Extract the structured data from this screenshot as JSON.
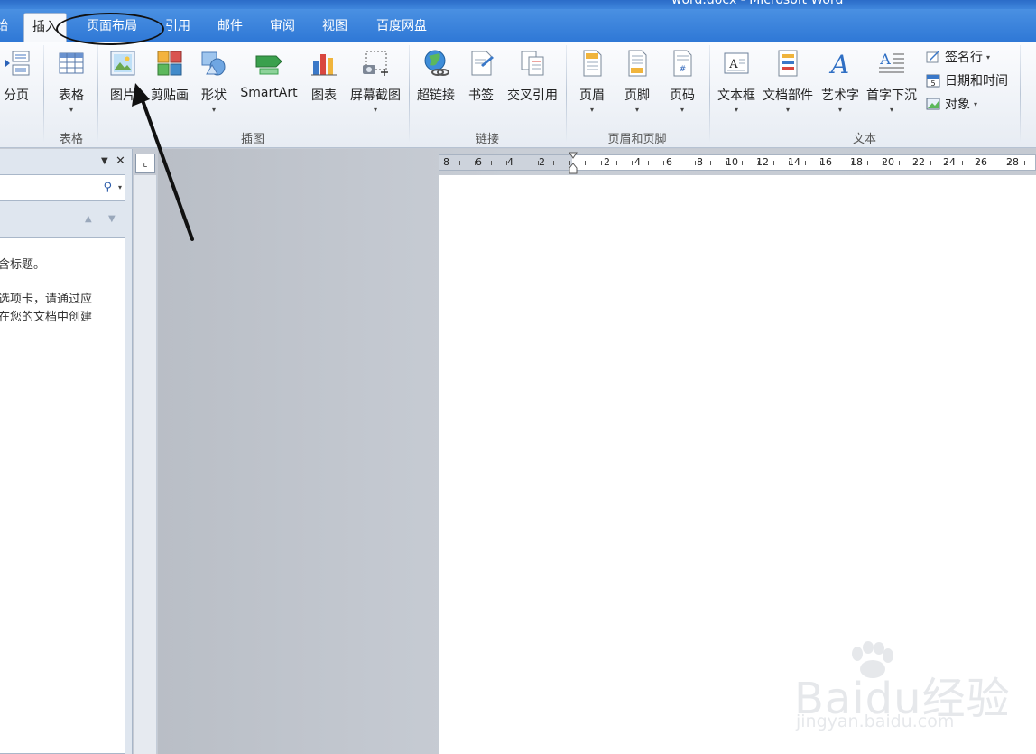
{
  "window": {
    "title": "word.docx - Microsoft Word"
  },
  "tabs": [
    "始",
    "插入",
    "页面布局",
    "引用",
    "邮件",
    "审阅",
    "视图",
    "百度网盘"
  ],
  "ribbon": {
    "page_break": "分页",
    "table": "表格",
    "picture": "图片",
    "clipart": "剪贴画",
    "shapes": "形状",
    "smartart": "SmartArt",
    "chart": "图表",
    "screenshot": "屏幕截图",
    "hyperlink": "超链接",
    "bookmark": "书签",
    "crossref": "交叉引用",
    "header": "页眉",
    "footer": "页脚",
    "pagenum": "页码",
    "textbox": "文本框",
    "quickparts": "文档部件",
    "wordart": "艺术字",
    "dropcap": "首字下沉",
    "signature": "签名行",
    "datetime": "日期和时间",
    "object": "对象",
    "groups": {
      "table": "表格",
      "illustrations": "插图",
      "links": "链接",
      "header_footer": "页眉和页脚",
      "text": "文本"
    }
  },
  "navpane": {
    "lines": [
      "含标题。",
      "选项卡，请通过应",
      "在您的文档中创建"
    ]
  },
  "ruler": {
    "left_marks": [
      "8",
      "6",
      "4",
      "2"
    ],
    "right_marks": [
      "2",
      "4",
      "6",
      "8",
      "10",
      "12",
      "14",
      "16",
      "18",
      "20",
      "22",
      "24",
      "26",
      "28"
    ]
  },
  "watermark": {
    "brand": "Baidu经验",
    "url": "jingyan.baidu.com"
  }
}
